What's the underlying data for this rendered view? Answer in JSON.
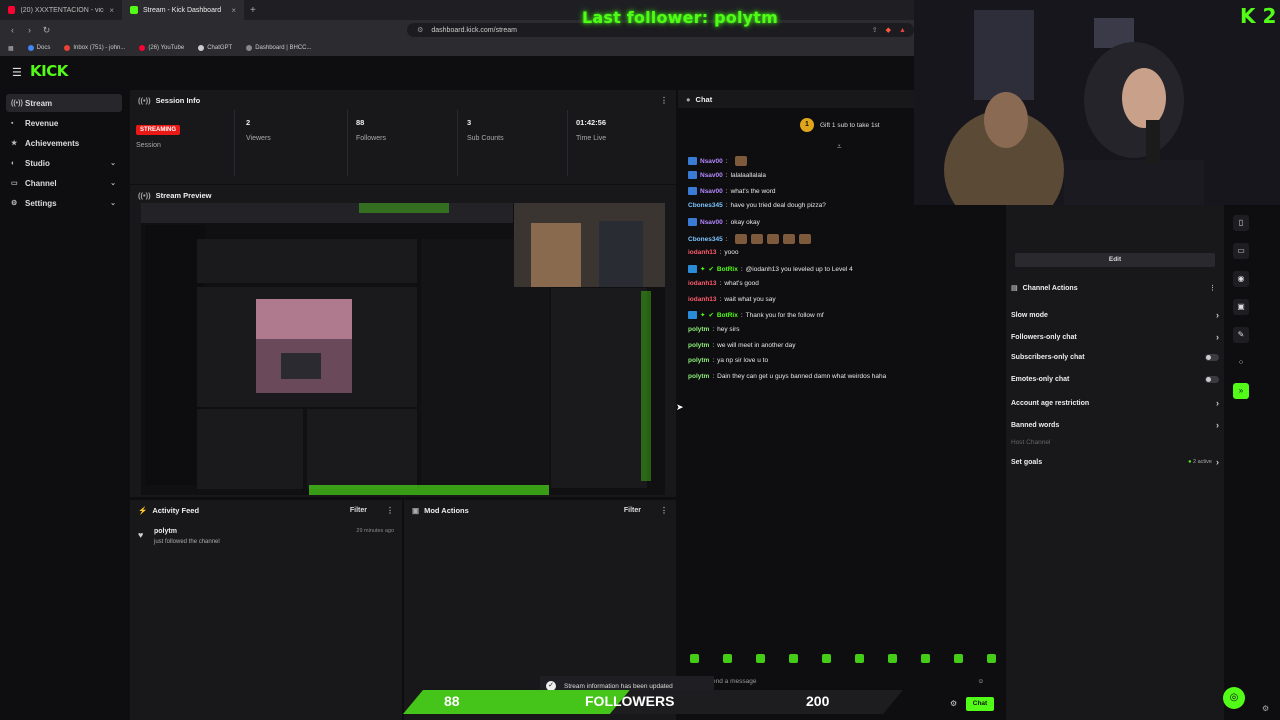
{
  "browser": {
    "tabs": [
      {
        "title": "(20) XXXTENTACION - vice city (i",
        "active": false,
        "fav_color": "#ff0033"
      },
      {
        "title": "Stream - Kick Dashboard",
        "active": true,
        "fav_color": "#53fc18"
      }
    ],
    "new_tab_icon": "plus-icon",
    "url": "dashboard.kick.com/stream",
    "bookmarks": [
      {
        "label": "Docs",
        "color": "#4285f4"
      },
      {
        "label": "Inbox (751) - john...",
        "color": "#ea4335"
      },
      {
        "label": "(26) YouTube",
        "color": "#ff0033"
      },
      {
        "label": "ChatGPT",
        "color": "#cccccc"
      },
      {
        "label": "Dashboard | BHCC...",
        "color": "#888888"
      }
    ]
  },
  "overlay": {
    "last_follower": "Last follower: polytm",
    "webcam_logo": "K 2",
    "followers_current": "88",
    "followers_label": "FOLLOWERS",
    "followers_goal": "200",
    "toast": "Stream information has been updated"
  },
  "kick": {
    "logo": "KICK"
  },
  "sidebar": {
    "items": [
      {
        "label": "Stream",
        "icon": "broadcast-icon"
      },
      {
        "label": "Revenue",
        "icon": "wallet-icon"
      },
      {
        "label": "Achievements",
        "icon": "star-icon"
      },
      {
        "label": "Studio",
        "icon": "palette-icon"
      },
      {
        "label": "Channel",
        "icon": "channel-icon"
      },
      {
        "label": "Settings",
        "icon": "gear-icon"
      }
    ]
  },
  "session": {
    "title": "Session Info",
    "badge": "STREAMING",
    "session_label": "Session",
    "viewers": "2",
    "viewers_label": "Viewers",
    "followers": "88",
    "followers_label": "Followers",
    "subs": "3",
    "subs_label": "Sub Counts",
    "time": "01:42:56",
    "time_label": "Time Live"
  },
  "preview": {
    "title": "Stream Preview"
  },
  "activity": {
    "title": "Activity Feed",
    "filter": "Filter",
    "item_user": "polytm",
    "item_text": "just followed the channel",
    "item_time": "29 minutes ago"
  },
  "mod": {
    "title": "Mod Actions",
    "filter": "Filter"
  },
  "chat": {
    "title": "Chat",
    "gift_text": "Gift 1 sub to take 1st",
    "gift_count": "1",
    "messages": [
      {
        "user": "Nsav00",
        "text": "",
        "color": "#b388ff",
        "badge": true,
        "emotes": 1
      },
      {
        "user": "Nsav00",
        "text": "lalalaallalala",
        "color": "#b388ff",
        "badge": true,
        "emotes": 0
      },
      {
        "user": "Nsav00",
        "text": "what's the word",
        "color": "#b388ff",
        "badge": true,
        "emotes": 0
      },
      {
        "user": "Cbones345",
        "text": "have you tried deal dough pizza?",
        "color": "#7cc4ff",
        "badge": false,
        "emotes": 0
      },
      {
        "user": "Nsav00",
        "text": "okay okay",
        "color": "#b388ff",
        "badge": true,
        "emotes": 0
      },
      {
        "user": "Cbones345",
        "text": "",
        "color": "#7cc4ff",
        "badge": false,
        "emotes": 5
      },
      {
        "user": "iodanh13",
        "text": "yooo",
        "color": "#ff5a6e",
        "badge": false,
        "emotes": 0
      },
      {
        "user": "BotRix",
        "text": "@iodanh13 you leveled up to Level 4",
        "color": "#53fc18",
        "badge": true,
        "emotes": 0
      },
      {
        "user": "iodanh13",
        "text": "what's good",
        "color": "#ff5a6e",
        "badge": false,
        "emotes": 0
      },
      {
        "user": "iodanh13",
        "text": "wait what you say",
        "color": "#ff5a6e",
        "badge": false,
        "emotes": 0
      },
      {
        "user": "BotRix",
        "text": "Thank you for the follow mf",
        "color": "#53fc18",
        "badge": true,
        "emotes": 0
      },
      {
        "user": "polytm",
        "text": "hey sirs",
        "color": "#8ef07a",
        "badge": false,
        "emotes": 0
      },
      {
        "user": "polytm",
        "text": "we will meet in another day",
        "color": "#8ef07a",
        "badge": false,
        "emotes": 0
      },
      {
        "user": "polytm",
        "text": "ya np sir love u to",
        "color": "#8ef07a",
        "badge": false,
        "emotes": 0
      },
      {
        "user": "polytm",
        "text": "Dain they can get u guys banned damn what weirdos haha",
        "color": "#8ef07a",
        "badge": false,
        "emotes": 0
      }
    ],
    "input_placeholder": "end a message",
    "send_label": "Chat"
  },
  "actions": {
    "edit_label": "Edit",
    "title": "Channel Actions",
    "items": [
      {
        "label": "Slow mode",
        "control": "chevron"
      },
      {
        "label": "Followers-only chat",
        "control": "chevron"
      },
      {
        "label": "Subscribers-only chat",
        "control": "toggle"
      },
      {
        "label": "Emotes-only chat",
        "control": "toggle"
      },
      {
        "label": "Account age restriction",
        "control": "chevron"
      },
      {
        "label": "Banned words",
        "control": "chevron"
      }
    ],
    "host_channel": "Host Channel",
    "set_goals": "Set goals",
    "goals_active": "2 active"
  },
  "colors": {
    "accent": "#53fc18",
    "live": "#e91916",
    "panel": "#18181b",
    "bg": "#0e0e10"
  }
}
